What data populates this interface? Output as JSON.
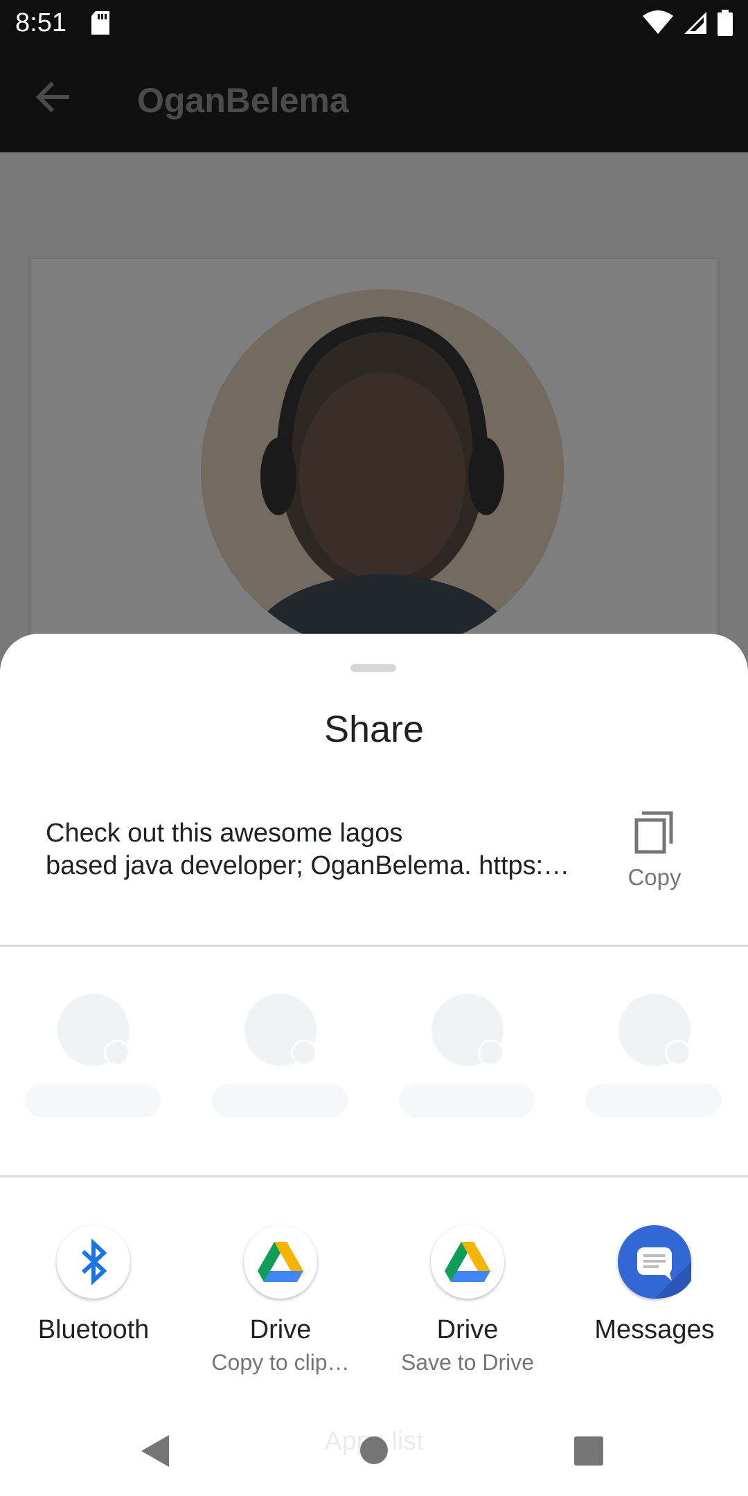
{
  "status_bar": {
    "time": "8:51",
    "icons": [
      "sd-card-icon",
      "wifi-icon",
      "signal-icon",
      "battery-icon"
    ]
  },
  "app_bar": {
    "title": "OganBelema",
    "back_icon": "arrow-left-icon"
  },
  "share_sheet": {
    "title": "Share",
    "shared_text": "Check out this awesome lagos\nbased java developer; OganBelema. https:…",
    "copy_label": "Copy",
    "targets": [
      {
        "label": "Bluetooth",
        "sub": "",
        "icon": "bluetooth-icon"
      },
      {
        "label": "Drive",
        "sub": "Copy to clip…",
        "icon": "google-drive-icon"
      },
      {
        "label": "Drive",
        "sub": "Save to Drive",
        "icon": "google-drive-icon"
      },
      {
        "label": "Messages",
        "sub": "",
        "icon": "messages-icon"
      }
    ]
  },
  "nav_bar": {
    "hint": "Apps list",
    "buttons": [
      "back-icon",
      "home-icon",
      "recents-icon"
    ]
  },
  "colors": {
    "bluetooth": "#1a73e8",
    "messages": "#3367d6",
    "drive_green": "#0f9d58",
    "drive_yellow": "#f4b400",
    "drive_blue": "#4285f4"
  }
}
